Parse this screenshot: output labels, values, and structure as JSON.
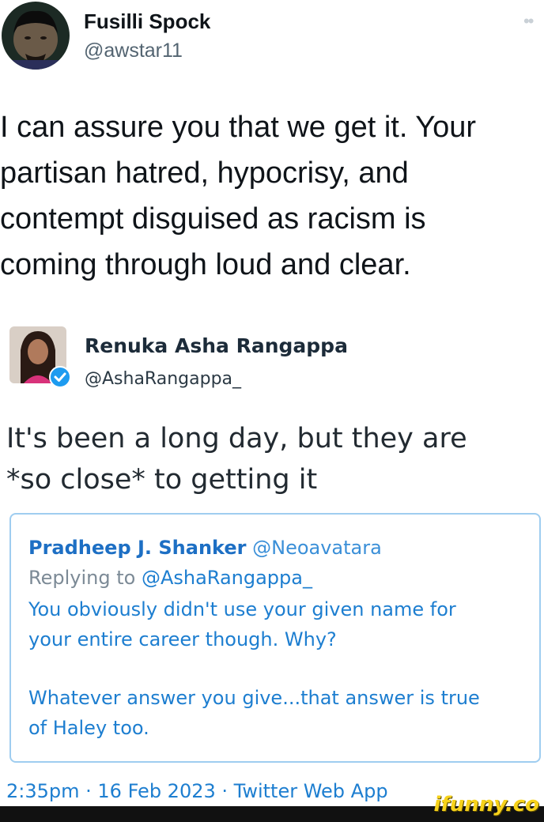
{
  "tweet": {
    "author": {
      "name": "Fusilli Spock",
      "handle": "@awstar11"
    },
    "more_icon": "more-dots-icon",
    "text_lines": [
      "I can assure you that we get it.  Your",
      "partisan hatred, hypocrisy, and",
      "contempt disguised as racism is",
      "coming through loud and clear."
    ]
  },
  "quoted_tweet": {
    "author": {
      "name": "Renuka Asha Rangappa",
      "handle": "@AshaRangappa_",
      "verified_icon": "verified-badge-icon"
    },
    "text_lines": [
      "It's been a long day, but they are",
      "*so close* to getting it"
    ],
    "embedded_reply": {
      "author_name": "Pradheep J. Shanker",
      "author_handle": "@Neoavatara",
      "replying_to_label": "Replying to",
      "replying_to_handle": "@AshaRangappa_",
      "lines": [
        "You obviously didn't use your given name for",
        "your entire career though. Why?",
        "",
        "Whatever answer you give...that answer is true",
        "of Haley too."
      ]
    },
    "timestamp": "2:35pm · 16 Feb 2023 · Twitter Web App"
  },
  "watermark": {
    "text": "ifunny.co"
  },
  "colors": {
    "link_blue": "#1d7ed0",
    "border_blue": "#9fcdf0",
    "watermark_yellow": "#f7d21a"
  }
}
